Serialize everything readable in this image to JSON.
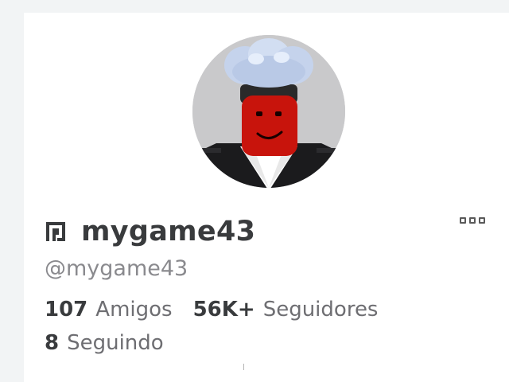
{
  "profile": {
    "display_name": "mygame43",
    "username": "@mygame43",
    "avatar_icon": "avatar-chef",
    "premium_icon": "premium-icon",
    "more_icon": "more-options-icon"
  },
  "stats": {
    "friends": {
      "value": "107",
      "label": "Amigos"
    },
    "followers": {
      "value": "56K+",
      "label": "Seguidores"
    },
    "following": {
      "value": "8",
      "label": "Seguindo"
    }
  },
  "colors": {
    "page_bg": "#f2f4f5",
    "card_bg": "#ffffff",
    "text_primary": "#393b3d",
    "text_secondary": "#6e6e72",
    "avatar_bg": "#c9c9cb"
  }
}
